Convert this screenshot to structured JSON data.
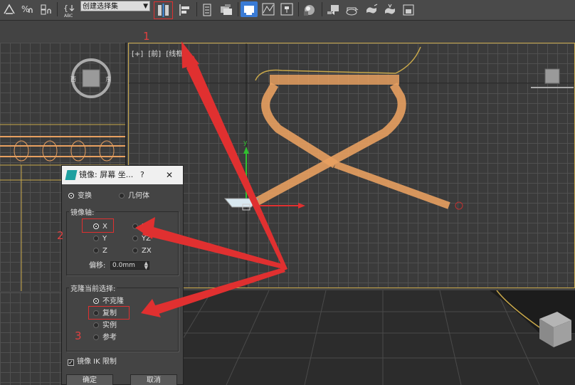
{
  "toolbar": {
    "items": [
      {
        "icon": "snap-toggle-icon",
        "label": "∠²"
      },
      {
        "icon": "percent-snap-icon",
        "label": "%ₙ"
      },
      {
        "icon": "spinner-snap-icon",
        "label": "⬍"
      },
      {
        "icon": "edit-named-selection-icon",
        "label": "{↓"
      }
    ],
    "abc_label": "ABC",
    "selection_set": "创建选择集",
    "icons": [
      "mirror-icon",
      "align-icon",
      "layer-manager-icon",
      "scene-explorer-icon",
      "ribbon-icon",
      "curve-editor-icon",
      "schematic-view-icon",
      "material-editor-icon",
      "render-setup-icon",
      "rendered-frame-icon",
      "render-icon",
      "render-iterative-icon",
      "render-production-icon"
    ]
  },
  "viewport_front": {
    "label_plus": "[+]",
    "label_view": "[前]",
    "label_mode": "[线框]"
  },
  "viewcube_left": {
    "w": "西",
    "e": "东"
  },
  "gizmo": {
    "y_label": "y"
  },
  "dialog": {
    "title": "镜像: 屏幕 坐...",
    "help": "?",
    "close": "✕",
    "mode_transform": "变换",
    "mode_geometry": "几何体",
    "mirror_axis_title": "镜像轴:",
    "axes": [
      "X",
      "Y",
      "Z",
      "XY",
      "YZ",
      "ZX"
    ],
    "selected_axis": "X",
    "offset_label": "偏移:",
    "offset_value": "0.0mm",
    "clone_title": "克隆当前选择:",
    "clone_options": [
      "不克隆",
      "复制",
      "实例",
      "参考"
    ],
    "selected_clone": "不克隆",
    "ik_label": "镜像 IK 限制",
    "ik_checked": true,
    "ok_label": "确定",
    "cancel_label": "取消"
  },
  "annotations": {
    "step1": "1",
    "step2": "2",
    "step3": "3",
    "color": "#e03030"
  },
  "colors": {
    "wireframe": "#e8a060",
    "selection": "#c9a84a",
    "x_axis": "#e03030",
    "y_axis": "#30c030"
  }
}
